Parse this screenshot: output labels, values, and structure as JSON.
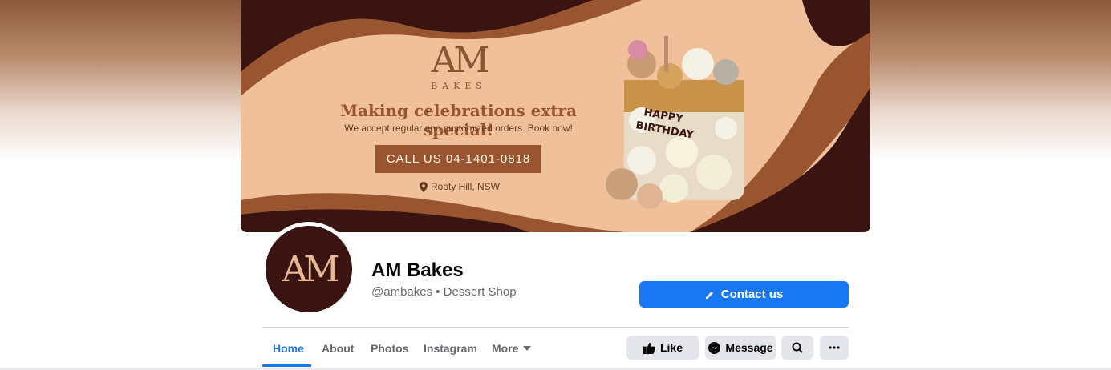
{
  "cover": {
    "logo_mark": "AM",
    "logo_sub": "BAKES",
    "headline": "Making celebrations extra special!",
    "subline": "We accept regular and customized orders. Book now!",
    "call_button": "CALL US  04-1401-0818",
    "location": "Rooty Hill, NSW",
    "cake_topper": [
      "HAPPY",
      "BIRTHDAY"
    ]
  },
  "profile": {
    "avatar_text": "AM",
    "name": "AM Bakes",
    "subtitle": "@ambakes • Dessert Shop",
    "contact_button": "Contact us"
  },
  "tabs": [
    {
      "label": "Home",
      "active": true
    },
    {
      "label": "About"
    },
    {
      "label": "Photos"
    },
    {
      "label": "Instagram"
    },
    {
      "label": "More",
      "icon": "caret-down-icon"
    }
  ],
  "actions": {
    "like": "Like",
    "message": "Message",
    "search_icon": "search-icon",
    "more_icon": "ellipsis-icon"
  },
  "colors": {
    "brand": "#98552f",
    "dark": "#3a1410",
    "peach": "#f0c09a",
    "accent": "#1877f2"
  }
}
